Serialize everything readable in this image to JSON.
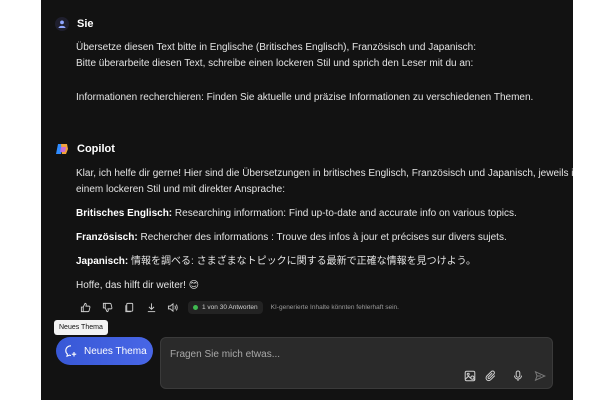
{
  "user_message": {
    "sender": "Sie",
    "lines": [
      "Übersetze diesen Text bitte in Englische (Britisches Englisch), Französisch und Japanisch:",
      "Bitte überarbeite diesen Text, schreibe einen lockeren Stil und sprich den Leser mit du an:",
      "Informationen recherchieren: Finden Sie aktuelle und präzise Informationen zu verschiedenen Themen."
    ]
  },
  "copilot_message": {
    "sender": "Copilot",
    "intro_line1": "Klar, ich helfe dir gerne! Hier sind die Übersetzungen in britisches Englisch, Französisch und Japanisch, jeweils in",
    "intro_line2": "einem lockeren Stil und mit direkter Ansprache:",
    "translations": [
      {
        "label": "Britisches Englisch:",
        "text": " Researching information: Find up-to-date and accurate info on various topics."
      },
      {
        "label": "Französisch:",
        "text": " Rechercher des informations : Trouve des infos à jour et précises sur divers sujets."
      },
      {
        "label": "Japanisch:",
        "text": " 情報を調べる: さまざまなトピックに関する最新で正確な情報を見つけよう。"
      }
    ],
    "closing": "Hoffe, das hilft dir weiter! 😊"
  },
  "actions": {
    "answers_badge": "1 von 30 Antworten",
    "disclaimer": "KI-generierte Inhalte könnten fehlerhaft sein."
  },
  "tooltip": "Neues Thema",
  "new_topic_label": "Neues Thema",
  "composer": {
    "placeholder": "Fragen Sie mich etwas..."
  },
  "colors": {
    "background": "#121212",
    "accent": "#3b5bdb",
    "status_dot": "#3fb950"
  }
}
